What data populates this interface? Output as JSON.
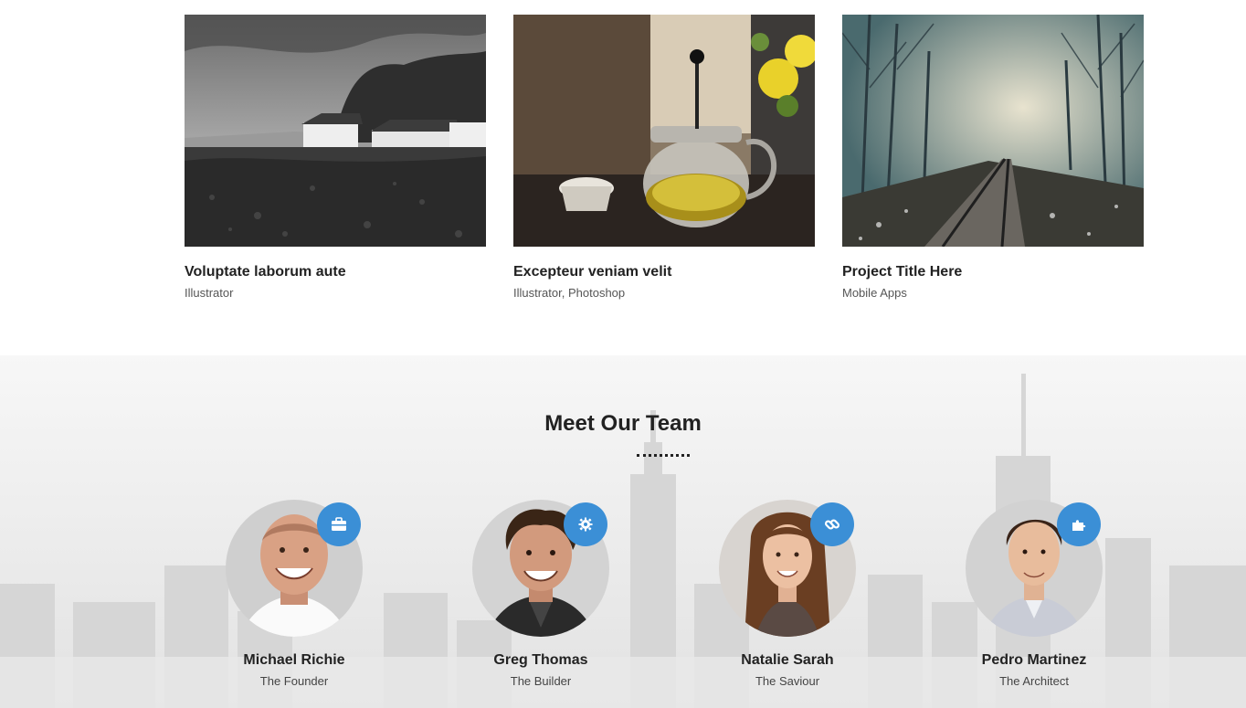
{
  "portfolio": {
    "items": [
      {
        "title": "Voluptate laborum aute",
        "category": "Illustrator",
        "image": "coastal-cottages-photo"
      },
      {
        "title": "Excepteur veniam velit",
        "category": "Illustrator, Photoshop",
        "image": "teapot-photo"
      },
      {
        "title": "Project Title Here",
        "category": "Mobile Apps",
        "image": "misty-railway-photo"
      }
    ]
  },
  "team": {
    "title": "Meet Our Team",
    "members": [
      {
        "name": "Michael Richie",
        "role": "The Founder",
        "icon": "briefcase-icon"
      },
      {
        "name": "Greg Thomas",
        "role": "The Builder",
        "icon": "gear-icon"
      },
      {
        "name": "Natalie Sarah",
        "role": "The Saviour",
        "icon": "link-icon"
      },
      {
        "name": "Pedro Martinez",
        "role": "The Architect",
        "icon": "puzzle-icon"
      }
    ]
  },
  "colors": {
    "accent": "#3b8fd6",
    "text": "#222222"
  }
}
